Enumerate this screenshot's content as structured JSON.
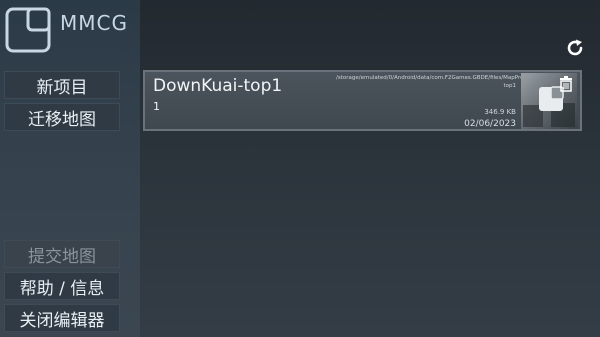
{
  "app": {
    "title": "MMCG",
    "logo_icon": "mmcg-logo"
  },
  "sidebar": {
    "buttons": [
      {
        "label": "新项目",
        "enabled": true
      },
      {
        "label": "迁移地图",
        "enabled": true
      },
      {
        "label": "提交地图",
        "enabled": false
      },
      {
        "label": "帮助 / 信息",
        "enabled": true
      },
      {
        "label": "关闭编辑器",
        "enabled": true
      }
    ]
  },
  "toolbar": {
    "refresh_icon": "refresh-icon"
  },
  "maps": [
    {
      "name": "DownKuai-top1",
      "description": "1",
      "path": "/storage/emulated/0/Android/data/com.F2Games.GBDE/files/MapProjects/DownKuai-top1",
      "size": "346.9 KB",
      "date": "02/06/2023",
      "delete_icon": "trash-icon"
    }
  ],
  "colors": {
    "accent": "#c9d6e3",
    "card_border": "#6a737b",
    "button_bg": "#2f3a44"
  }
}
